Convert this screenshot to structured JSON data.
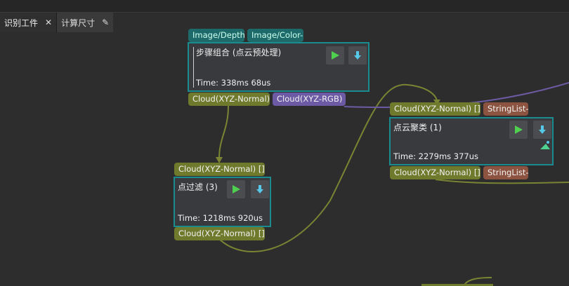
{
  "tabs": [
    {
      "label": "识别工件",
      "active": true
    },
    {
      "label": "计算尺寸",
      "active": false
    }
  ],
  "top_ports": [
    "Image/Depth",
    "Image/Color-"
  ],
  "node_step": {
    "title": "步骤组合 (点云预处理)",
    "time": "Time: 338ms 68us",
    "out_ports": [
      "Cloud(XYZ-Normal)",
      "Cloud(XYZ-RGB)"
    ]
  },
  "node_cluster": {
    "in_ports": [
      "Cloud(XYZ-Normal) []",
      "StringList-"
    ],
    "title": "点云聚类 (1)",
    "time": "Time: 2279ms 377us",
    "out_ports": [
      "Cloud(XYZ-Normal) []",
      "StringList-"
    ]
  },
  "node_filter": {
    "in_port": "Cloud(XYZ-Normal) []",
    "title": "点过滤 (3)",
    "time": "Time: 1218ms 920us",
    "out_port": "Cloud(XYZ-Normal) []"
  },
  "colors": {
    "olive": "#6f7a2c",
    "purple": "#6c5ba4",
    "brown": "#8c5340",
    "node_border": "#1a8b8f",
    "run_icon": "#4fd14f",
    "download_icon": "#56c8e8"
  },
  "icons": [
    "pin-icon",
    "run-icon",
    "download-icon",
    "view-icon"
  ]
}
